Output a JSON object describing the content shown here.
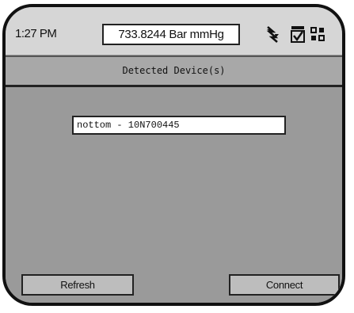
{
  "status_bar": {
    "time": "1:27 PM",
    "pressure_reading": "733.8244 Bar mmHg",
    "icons": [
      "signal-icon",
      "checkmark-icon",
      "battery-icon"
    ]
  },
  "title_bar": {
    "title": "Detected Device(s)"
  },
  "device_list": {
    "items": [
      {
        "label": "nottom - 10N700445"
      }
    ]
  },
  "buttons": {
    "refresh_label": "Refresh",
    "connect_label": "Connect"
  },
  "colors": {
    "screen_background": "#9a9a9a",
    "status_bar_background": "#d6d6d6",
    "title_bar_background": "#a8a8a8",
    "frame": "#111111"
  }
}
